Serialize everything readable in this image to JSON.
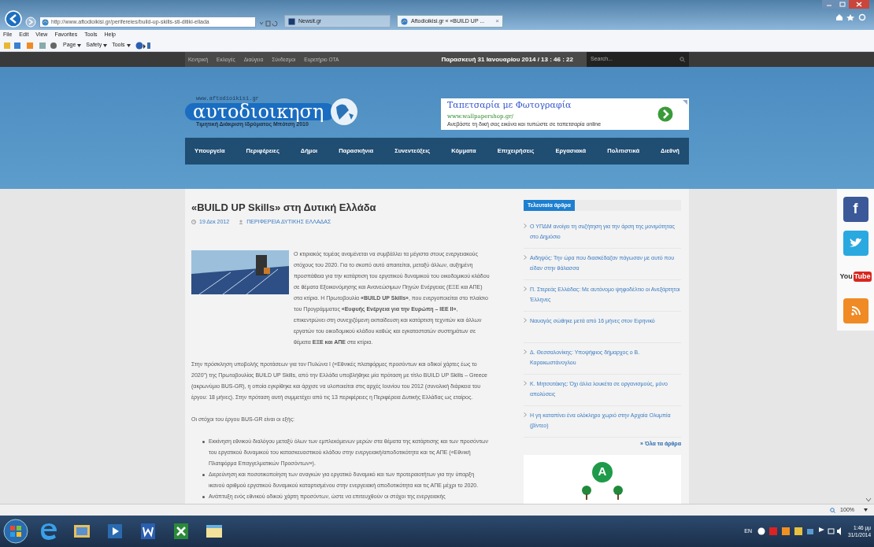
{
  "browser": {
    "url": "http://www.aftodioikisi.gr/perifereies/build-up-skills-sti-ditiki-ellada",
    "tabs": [
      {
        "label": "Newsit.gr",
        "selected": false
      },
      {
        "label": "Aftodioikisi.gr « «BUILD UP ...",
        "selected": true,
        "close": "×"
      }
    ],
    "menu": [
      "File",
      "Edit",
      "View",
      "Favorites",
      "Tools",
      "Help"
    ],
    "commands": [
      "Page",
      "Safety",
      "Tools"
    ]
  },
  "site": {
    "top_links": [
      "Κεντρική",
      "Εκλογές",
      "Διαύγεια",
      "Σύνδεσμοι",
      "Ευρετήριο ΟΤΑ"
    ],
    "datetime": "Παρασκευή 31 Ιανουαρίου 2014 / 13 : 46 : 22",
    "search": {
      "placeholder": "Search..."
    },
    "logo": {
      "url": "www.aftodioikisi.gr",
      "name": "αυτοδιοικηση",
      "award": "Τιμητική Διάκριση Ιδρύματος Μπότση 2010"
    },
    "ad": {
      "title": "Ταπετσαρία με Φωτογραφία",
      "url": "www.wallpapershop.gr/",
      "text": "Ανεβάστε τη δική σας εικόνα και τυπώστε σε ταπετσαρία online"
    },
    "nav": [
      "Υπουργεία",
      "Περιφέρειες",
      "Δήμοι",
      "Παρασκήνια",
      "Συνεντεύξεις",
      "Κόμματα",
      "Επιχειρήσεις",
      "Εργασιακά",
      "Πολιτιστικά",
      "Διεθνή"
    ]
  },
  "article": {
    "title": "«BUILD UP Skills» στη Δυτική Ελλάδα",
    "date": "19 Δεκ 2012",
    "category": "ΠΕΡΙΦΕΡΕΙΑ ΔΥΤΙΚΗΣ ΕΛΛΑΔΑΣ",
    "paragraphs": [
      "Ο κτιριακός τομέας αναμένεται να συμβάλλει τα μέγιστα στους ενεργειακούς στόχους του 2020. Για το σκοπό αυτό απαιτείται, μεταξύ άλλων, αυξημένη προσπάθεια για την κατάρτιση του εργατικού δυναμικού του οικοδομικού κλάδου σε θέματα Εξοικονόμησης και Ανανεώσιμων Πηγών Ενέργειας (ΕΞΕ και ΑΠΕ) στα κτίρια. Η Πρωτοβουλία **«BUILD UP Skills»**, που ενεργοποιείται στο πλαίσιο του Προγράμματος **«Ευφυής Ενέργεια για την Ευρώπη – ΙΕΕ ΙΙ»**, επικεντρώνει στη συνεχιζόμενη εκπαίδευση και κατάρτιση τεχνιτών και άλλων εργατών του οικοδομικού κλάδου καθώς και εγκαταστατών συστημάτων σε θέματα **ΕΞΕ και ΑΠΕ** στα κτίρια.",
      "Στην πρόσκληση υποβολής προτάσεων για τον Πυλώνα Ι («Εθνικές πλατφόρμες προσόντων και οδικοί χάρτες έως το 2020\") της Πρωτοβουλίας BUILD UP Skills, από την Ελλάδα υποβλήθηκε μία πρόταση με τίτλο BUILD UP Skills – Greece (ακρωνύμιο BUS-GR), η οποία εγκρίθηκε και άρχισε να υλοποιείται στις αρχές Ιουνίου του 2012 (συνολική διάρκεια του έργου: 18 μήνες). Στην πρόταση αυτή συμμετέχει από τις 13 περιφέρειες η Περιφέρεια Δυτικής Ελλάδας ως εταίρος.",
      "Οι στόχοι του έργου BUS-GR είναι οι εξής:"
    ],
    "bullets": [
      "Εκκίνηση εθνικού διαλόγου μεταξύ όλων των εμπλεκόμενων μερών στα θέματα της κατάρτισης και των προσόντων του εργατικού δυναμικού του κατασκευαστικού κλάδου στην ενεργειακή/αποδοτικότητα και τις ΑΠΕ («Εθνική Πλατφόρμα Επαγγελματικών Προσόντων»).",
      "Διερεύνηση και ποσοτικοποίηση των αναγκών για εργατικό δυναμικό και των προτεραιοτήτων για την ύπαρξη ικανού αριθμού εργατικού δυναμικού καταρτισμένου στην ενεργειακή αποδοτικότητα και τις ΑΠΕ μέχρι το 2020.",
      "Ανάπτυξη ενός εθνικού οδικού χάρτη προσόντων, ώστε να επιτευχθούν οι στόχοι της ενεργειακής"
    ]
  },
  "sidebar": {
    "title": "Τελευταία άρθρα",
    "items": [
      "Ο ΥΠΔΜ ανοίγει τη συζήτηση για την άρση της μονιμότητας στο Δημόσιο",
      "Αιδηψός: Την ώρα που διασκέδαζαν πάγωσαν με αυτό που είδαν στην θάλασσα",
      "Π. Στερεάς Ελλάδας: Με αυτόνομο ψηφοδέλτιο οι Ανεξάρτητοι Έλληνες",
      "Ναυαγός σώθηκε μετά από 16 μήνες στον Ειρηνικό",
      "Δ. Θεσσαλονίκης: Υποψήφιος δήμαρχος ο Β. Καρακωστάνογλου",
      "Κ. Μητσοτάκης: Όχι άλλα λουκέτα σε οργανισμούς, μόνο απολύσεις",
      "Η γη καταπίνει ένα ολόκληρο χωριό στην Αρχαία Ολυμπία (βίντεο)"
    ],
    "all_link": "» Όλα τα άρθρα",
    "badge": "A"
  },
  "social": [
    {
      "kind": "facebook",
      "label": "f"
    },
    {
      "kind": "twitter"
    },
    {
      "kind": "youtube",
      "label": "You",
      "label2": "Tube"
    },
    {
      "kind": "rss"
    }
  ],
  "status_bar": {
    "zoom": "100%"
  },
  "taskbar": {
    "language": "EN",
    "time": "1:46 μμ",
    "date": "31/1/2014"
  }
}
